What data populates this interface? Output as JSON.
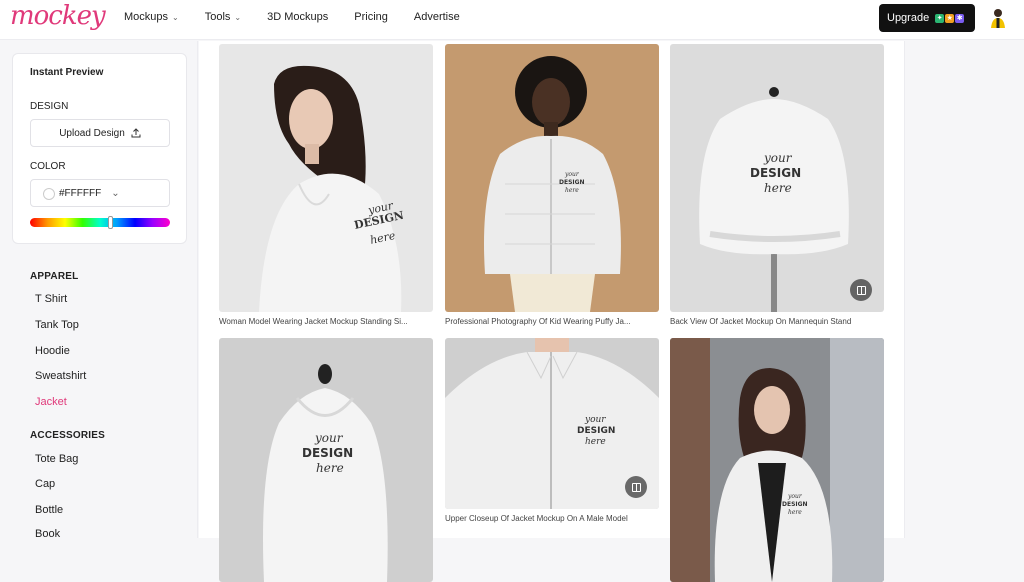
{
  "brand": {
    "logo": "mockey"
  },
  "nav": [
    {
      "label": "Mockups",
      "dropdown": true
    },
    {
      "label": "Tools",
      "dropdown": true
    },
    {
      "label": "3D Mockups",
      "dropdown": false
    },
    {
      "label": "Pricing",
      "dropdown": false
    },
    {
      "label": "Advertise",
      "dropdown": false
    }
  ],
  "upgrade": {
    "label": "Upgrade"
  },
  "preview": {
    "title": "Instant Preview",
    "design_label": "DESIGN",
    "upload_label": "Upload Design",
    "color_label": "COLOR",
    "color_value": "#FFFFFF"
  },
  "apparel": {
    "title": "APPAREL",
    "items": [
      "T Shirt",
      "Tank Top",
      "Hoodie",
      "Sweatshirt",
      "Jacket"
    ],
    "active": "Jacket"
  },
  "accessories": {
    "title": "ACCESSORIES",
    "items": [
      "Tote Bag",
      "Cap",
      "Bottle",
      "Book"
    ]
  },
  "cards": [
    {
      "caption": "Woman Model Wearing Jacket Mockup Standing Si...",
      "design_text": [
        "your",
        "DESIGN",
        "here"
      ]
    },
    {
      "caption": "Professional Photography Of Kid Wearing Puffy Ja...",
      "design_text": [
        "your",
        "DESIGN",
        "here"
      ]
    },
    {
      "caption": "Back View Of Jacket Mockup On Mannequin Stand",
      "design_text": [
        "your",
        "DESIGN",
        "here"
      ]
    },
    {
      "caption": "",
      "design_text": [
        "your",
        "DESIGN",
        "here"
      ]
    },
    {
      "caption": "Upper Closeup Of Jacket Mockup On A Male Model",
      "design_text": [
        "your",
        "DESIGN",
        "here"
      ]
    },
    {
      "caption": "",
      "design_text": [
        "your",
        "DESIGN",
        "here"
      ]
    }
  ],
  "colors": {
    "accent": "#e0397a",
    "upgrade_bg": "#111111"
  }
}
